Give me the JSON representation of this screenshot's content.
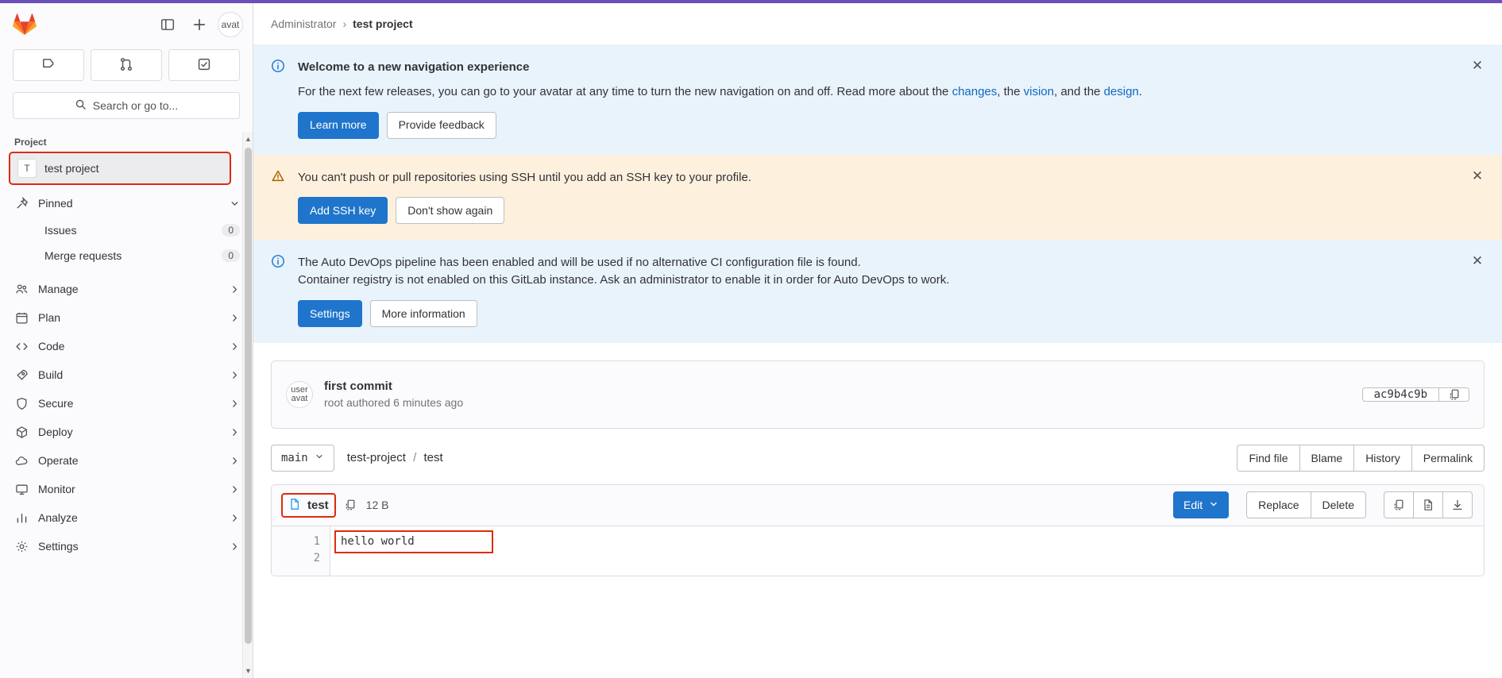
{
  "sidebar": {
    "logo_icon": "gitlab-logo-icon",
    "toggle_sidebar_icon": "panel-toggle-icon",
    "new_icon": "plus-icon",
    "avatar_text": "avat",
    "tabs": [
      {
        "name": "issues-tab",
        "icon": "issue-icon"
      },
      {
        "name": "merge-requests-tab",
        "icon": "merge-request-icon"
      },
      {
        "name": "todos-tab",
        "icon": "todo-checkbox-icon"
      }
    ],
    "search_placeholder": "Search or go to...",
    "section_label": "Project",
    "project": {
      "initial": "T",
      "name": "test project"
    },
    "pinned": {
      "label": "Pinned",
      "icon": "pin-icon"
    },
    "pinned_items": [
      {
        "label": "Issues",
        "count": "0"
      },
      {
        "label": "Merge requests",
        "count": "0"
      }
    ],
    "items": [
      {
        "label": "Manage",
        "icon": "users-icon"
      },
      {
        "label": "Plan",
        "icon": "calendar-icon"
      },
      {
        "label": "Code",
        "icon": "code-icon"
      },
      {
        "label": "Build",
        "icon": "rocket-icon"
      },
      {
        "label": "Secure",
        "icon": "shield-icon"
      },
      {
        "label": "Deploy",
        "icon": "deploy-icon"
      },
      {
        "label": "Operate",
        "icon": "cloud-gear-icon"
      },
      {
        "label": "Monitor",
        "icon": "monitor-icon"
      },
      {
        "label": "Analyze",
        "icon": "chart-icon"
      },
      {
        "label": "Settings",
        "icon": "gear-icon"
      }
    ]
  },
  "breadcrumb": {
    "root": "Administrator",
    "separator": "›",
    "current": "test project"
  },
  "alerts": [
    {
      "type": "info",
      "icon": "info-circle-icon",
      "title": "Welcome to a new navigation experience",
      "body_1": "For the next few releases, you can go to your avatar at any time to turn the new navigation on and off. Read more about the ",
      "link_1": "changes",
      "body_2": ", the ",
      "link_2": "vision",
      "body_3": ", and the ",
      "link_3": "design",
      "body_4": ".",
      "primary_action": "Learn more",
      "secondary_action": "Provide feedback",
      "close_icon": "close-icon"
    },
    {
      "type": "warn",
      "icon": "warning-triangle-icon",
      "body": "You can't push or pull repositories using SSH until you add an SSH key to your profile.",
      "primary_action": "Add SSH key",
      "secondary_action": "Don't show again",
      "close_icon": "close-icon"
    },
    {
      "type": "info",
      "icon": "info-circle-icon",
      "line_1": "The Auto DevOps pipeline has been enabled and will be used if no alternative CI configuration file is found.",
      "line_2": "Container registry is not enabled on this GitLab instance. Ask an administrator to enable it in order for Auto DevOps to work.",
      "primary_action": "Settings",
      "secondary_action": "More information",
      "close_icon": "close-icon"
    }
  ],
  "commit": {
    "avatar_line_1": "user",
    "avatar_line_2": "avat",
    "title": "first commit",
    "meta": "root authored 6 minutes ago",
    "sha": "ac9b4c9b",
    "copy_icon": "copy-icon"
  },
  "file_toolbar": {
    "branch": "main",
    "branch_chevron_icon": "chevron-down-icon",
    "path": [
      {
        "label": "test-project"
      },
      {
        "label": "test"
      }
    ],
    "path_separator": "/",
    "actions": [
      "Find file",
      "Blame",
      "History",
      "Permalink"
    ]
  },
  "file": {
    "icon": "document-icon",
    "name": "test",
    "copy_path_icon": "copy-icon",
    "size": "12 B",
    "edit_label": "Edit",
    "edit_chevron_icon": "chevron-down-icon",
    "replace_label": "Replace",
    "delete_label": "Delete",
    "copy_contents_icon": "copy-icon",
    "open_raw_icon": "file-raw-icon",
    "download_icon": "download-icon",
    "line_numbers": [
      "1",
      "2"
    ],
    "lines": [
      "hello world",
      ""
    ]
  },
  "colors": {
    "accent_blue": "#1f75cb",
    "link_blue": "#1068bf",
    "alert_info_bg": "#e9f3fc",
    "alert_warn_bg": "#fdf1dd",
    "highlight_red": "#dd2b0e",
    "brand_purple": "#6b4fbb"
  }
}
